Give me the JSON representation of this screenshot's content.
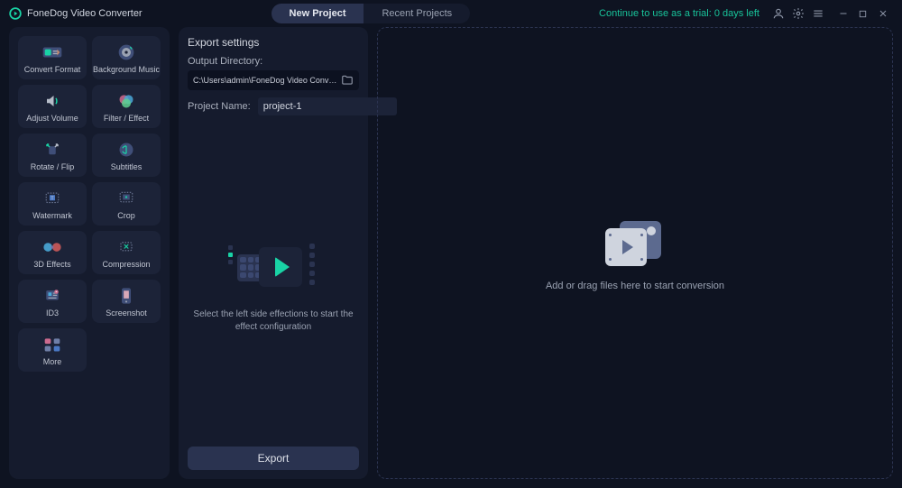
{
  "app": {
    "name": "FoneDog Video Converter"
  },
  "header": {
    "tab_new": "New Project",
    "tab_recent": "Recent Projects",
    "trial_text": "Continue to use as a trial: 0 days left"
  },
  "tools": [
    {
      "id": "convert-format",
      "label": "Convert Format"
    },
    {
      "id": "background-music",
      "label": "Background Music"
    },
    {
      "id": "adjust-volume",
      "label": "Adjust Volume"
    },
    {
      "id": "filter-effect",
      "label": "Filter / Effect"
    },
    {
      "id": "rotate-flip",
      "label": "Rotate / Flip"
    },
    {
      "id": "subtitles",
      "label": "Subtitles"
    },
    {
      "id": "watermark",
      "label": "Watermark"
    },
    {
      "id": "crop",
      "label": "Crop"
    },
    {
      "id": "3d-effects",
      "label": "3D Effects"
    },
    {
      "id": "compression",
      "label": "Compression"
    },
    {
      "id": "id3",
      "label": "ID3"
    },
    {
      "id": "screenshot",
      "label": "Screenshot"
    },
    {
      "id": "more",
      "label": "More"
    }
  ],
  "settings": {
    "title": "Export settings",
    "output_dir_label": "Output Directory:",
    "output_dir_value": "C:\\Users\\admin\\FoneDog Video Converter\\Converted",
    "project_name_label": "Project Name:",
    "project_name_value": "project-1",
    "hint": "Select the left side effections to start the effect configuration",
    "export_label": "Export"
  },
  "dropzone": {
    "hint": "Add or drag files here to start conversion"
  }
}
